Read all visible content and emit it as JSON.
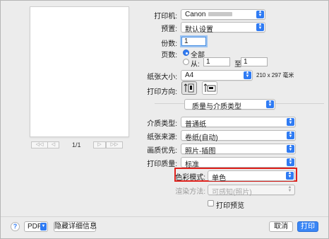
{
  "printer": {
    "label": "打印机:",
    "value": "Canon"
  },
  "presets": {
    "label": "预置:",
    "value": "默认设置"
  },
  "copies": {
    "label": "份数:",
    "value": "1"
  },
  "pages": {
    "label": "页数:",
    "all": "全部",
    "from": "从:",
    "from_value": "1",
    "to": "至:",
    "to_value": "1"
  },
  "paper_size": {
    "label": "纸张大小:",
    "value": "A4",
    "dims": "210 x 297 毫米"
  },
  "orientation": {
    "label": "打印方向:"
  },
  "section": {
    "value": "质量与介质类型"
  },
  "media_type": {
    "label": "介质类型:",
    "value": "普通纸"
  },
  "paper_source": {
    "label": "纸张来源:",
    "value": "卷纸(自动)"
  },
  "quality_priority": {
    "label": "画质优先:",
    "value": "照片-插图"
  },
  "print_quality": {
    "label": "打印质量:",
    "value": "标准"
  },
  "color_mode": {
    "label": "色彩模式:",
    "value": "单色"
  },
  "rendering": {
    "label": "渲染方法:",
    "value": "可感知(照片)"
  },
  "print_preview": {
    "label": "打印预览"
  },
  "page_nav": {
    "indicator": "1/1",
    "first": "◁◁",
    "prev": "◁",
    "next": "▷",
    "last": "▷▷"
  },
  "footer": {
    "help": "?",
    "pdf": "PDF",
    "hide_details": "隐藏详细信息",
    "cancel": "取消",
    "print": "打印"
  },
  "colors": {
    "accent": "#2f7bf3",
    "highlight": "#e0211c"
  }
}
